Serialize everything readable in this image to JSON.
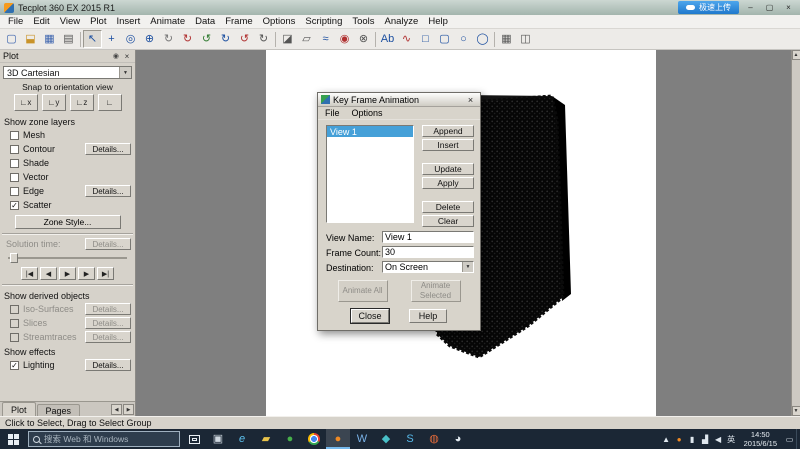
{
  "window": {
    "title": "Tecplot 360 EX 2015 R1",
    "upload_badge": "极速上传",
    "minimize_glyph": "–",
    "maximize_glyph": "▢",
    "close_glyph": "×"
  },
  "menubar": {
    "items": [
      "File",
      "Edit",
      "View",
      "Plot",
      "Insert",
      "Animate",
      "Data",
      "Frame",
      "Options",
      "Scripting",
      "Tools",
      "Analyze",
      "Help"
    ]
  },
  "toolbar": {
    "icons": [
      {
        "name": "new-layout-icon",
        "glyph": "▢",
        "color": "#3a62ad"
      },
      {
        "name": "open-layout-icon",
        "glyph": "⬓",
        "color": "#c9932a"
      },
      {
        "name": "save-layout-icon",
        "glyph": "▦",
        "color": "#3a62ad"
      },
      {
        "name": "print-icon",
        "glyph": "▤",
        "color": "#555555"
      },
      {
        "sep": true
      },
      {
        "name": "selector-tool-icon",
        "glyph": "↖",
        "color": "#1c4fa0",
        "pressed": true
      },
      {
        "name": "adjustor-tool-icon",
        "glyph": "+",
        "color": "#1c4fa0"
      },
      {
        "name": "zoom-tool-icon",
        "glyph": "◎",
        "color": "#1c4fa0"
      },
      {
        "name": "translate-tool-icon",
        "glyph": "⊕",
        "color": "#1c4fa0"
      },
      {
        "name": "smooth-rotate-tool-icon",
        "glyph": "↻",
        "color": "#777777"
      },
      {
        "name": "rotate-x-tool-icon",
        "glyph": "↻",
        "color": "#b03030"
      },
      {
        "name": "rotate-y-tool-icon",
        "glyph": "↺",
        "color": "#2f7a2f"
      },
      {
        "name": "rotate-z-tool-icon",
        "glyph": "↻",
        "color": "#1c4fa0"
      },
      {
        "name": "twist-rotate-tool-icon",
        "glyph": "↺",
        "color": "#b03030"
      },
      {
        "name": "rollerball-rotate-tool-icon",
        "glyph": "↻",
        "color": "#555555"
      },
      {
        "sep": true
      },
      {
        "name": "slice-tool-icon",
        "glyph": "◪",
        "color": "#555555"
      },
      {
        "name": "iso-surface-tool-icon",
        "glyph": "▱",
        "color": "#555555"
      },
      {
        "name": "streamtrace-tool-icon",
        "glyph": "≈",
        "color": "#1c4fa0"
      },
      {
        "name": "contour-add-tool-icon",
        "glyph": "◉",
        "color": "#b03030"
      },
      {
        "name": "probe-tool-icon",
        "glyph": "⊗",
        "color": "#555555"
      },
      {
        "sep": true
      },
      {
        "name": "text-tool-icon",
        "glyph": "Ab",
        "color": "#1c4fa0"
      },
      {
        "name": "polyline-tool-icon",
        "glyph": "∿",
        "color": "#b03030"
      },
      {
        "name": "rectangle-tool-icon",
        "glyph": "□",
        "color": "#1c4fa0"
      },
      {
        "name": "rounded-rect-tool-icon",
        "glyph": "▢",
        "color": "#1c4fa0"
      },
      {
        "name": "circle-tool-icon",
        "glyph": "○",
        "color": "#1c4fa0"
      },
      {
        "name": "ellipse-tool-icon",
        "glyph": "◯",
        "color": "#1c4fa0"
      },
      {
        "sep": true
      },
      {
        "name": "create-zone-icon",
        "glyph": "▦",
        "color": "#555555"
      },
      {
        "name": "extract-zone-icon",
        "glyph": "◫",
        "color": "#555555"
      }
    ]
  },
  "sidebar": {
    "panel_title": "Plot",
    "plot_type": "3D Cartesian",
    "snap_label": "Snap to orientation view",
    "snap_buttons": [
      {
        "name": "snap-x-view-button",
        "glyph": "∟x"
      },
      {
        "name": "snap-y-view-button",
        "glyph": "∟y"
      },
      {
        "name": "snap-z-view-button",
        "glyph": "∟z"
      },
      {
        "name": "snap-iso-view-button",
        "glyph": "∟"
      }
    ],
    "zone_layers_label": "Show zone layers",
    "details_label": "Details...",
    "zone_layers": [
      {
        "label": "Mesh",
        "checked": false,
        "details": false
      },
      {
        "label": "Contour",
        "checked": false,
        "details": true
      },
      {
        "label": "Shade",
        "checked": false,
        "details": false
      },
      {
        "label": "Vector",
        "checked": false,
        "details": false
      },
      {
        "label": "Edge",
        "checked": false,
        "details": true
      },
      {
        "label": "Scatter",
        "checked": true,
        "details": false
      }
    ],
    "zone_style_button": "Zone Style...",
    "solution_time_label": "Solution time:",
    "playback": [
      {
        "name": "jump-start-button",
        "glyph": "|◀"
      },
      {
        "name": "step-back-button",
        "glyph": "◀"
      },
      {
        "name": "play-button",
        "glyph": "▶"
      },
      {
        "name": "step-forward-button",
        "glyph": "▶"
      },
      {
        "name": "jump-end-button",
        "glyph": "▶|"
      }
    ],
    "derived_label": "Show derived objects",
    "derived_objects": [
      {
        "label": "Iso-Surfaces",
        "checked": false,
        "details": true,
        "disabled": true
      },
      {
        "label": "Slices",
        "checked": false,
        "details": true,
        "disabled": true
      },
      {
        "label": "Streamtraces",
        "checked": false,
        "details": true,
        "disabled": true
      }
    ],
    "effects_label": "Show effects",
    "effects": [
      {
        "label": "Lighting",
        "checked": true,
        "details": true
      }
    ],
    "tabs": [
      "Plot",
      "Pages"
    ]
  },
  "dialog": {
    "title": "Key Frame Animation",
    "menu": [
      "File",
      "Options"
    ],
    "views": [
      "View 1"
    ],
    "side_buttons": [
      "Append",
      "Insert",
      "Update",
      "Apply",
      "Delete",
      "Clear"
    ],
    "view_name_label": "View Name:",
    "view_name_value": "View 1",
    "frame_count_label": "Frame Count:",
    "frame_count_value": "30",
    "destination_label": "Destination:",
    "destination_value": "On Screen",
    "animate_all_button": "Animate All",
    "animate_selected_button": "Animate Selected",
    "close_button": "Close",
    "help_button": "Help"
  },
  "statusbar": {
    "text": "Click to Select, Drag to Select Group"
  },
  "taskbar": {
    "search_placeholder": "搜索 Web 和 Windows",
    "apps": [
      {
        "name": "taskbar-app-window",
        "glyph": "▣",
        "fg": "#cfd8e0"
      },
      {
        "name": "taskbar-app-ie",
        "glyph": "e",
        "fg": "#5ec3f0",
        "italic": true
      },
      {
        "name": "taskbar-app-explorer",
        "glyph": "▰",
        "fg": "#e8c34a"
      },
      {
        "name": "taskbar-app-360",
        "glyph": "●",
        "fg": "#47b04b"
      },
      {
        "name": "taskbar-app-chrome",
        "cls": "chrome"
      },
      {
        "name": "taskbar-app-tecplot",
        "glyph": "●",
        "fg": "#f08a24",
        "active": true
      },
      {
        "name": "taskbar-app-word",
        "glyph": "W",
        "fg": "#7ab3e8"
      },
      {
        "name": "taskbar-app-viewer",
        "glyph": "◆",
        "fg": "#49c0c8"
      },
      {
        "name": "taskbar-app-skype",
        "glyph": "S",
        "fg": "#57b8e8"
      },
      {
        "name": "taskbar-app-browser",
        "glyph": "◍",
        "fg": "#e06a3a"
      },
      {
        "name": "taskbar-app-qq",
        "glyph": "◕",
        "fg": "#dfe7ee"
      }
    ],
    "tray": [
      {
        "name": "tray-expand-icon",
        "glyph": "▲"
      },
      {
        "name": "tray-tecplot-icon",
        "glyph": "●",
        "fg": "#f08a24"
      },
      {
        "name": "battery-icon",
        "glyph": "▮"
      },
      {
        "name": "network-icon",
        "glyph": "▟"
      },
      {
        "name": "volume-icon",
        "glyph": "◀"
      }
    ],
    "ime": "英",
    "time": "14:50",
    "date": "2015/6/15"
  }
}
